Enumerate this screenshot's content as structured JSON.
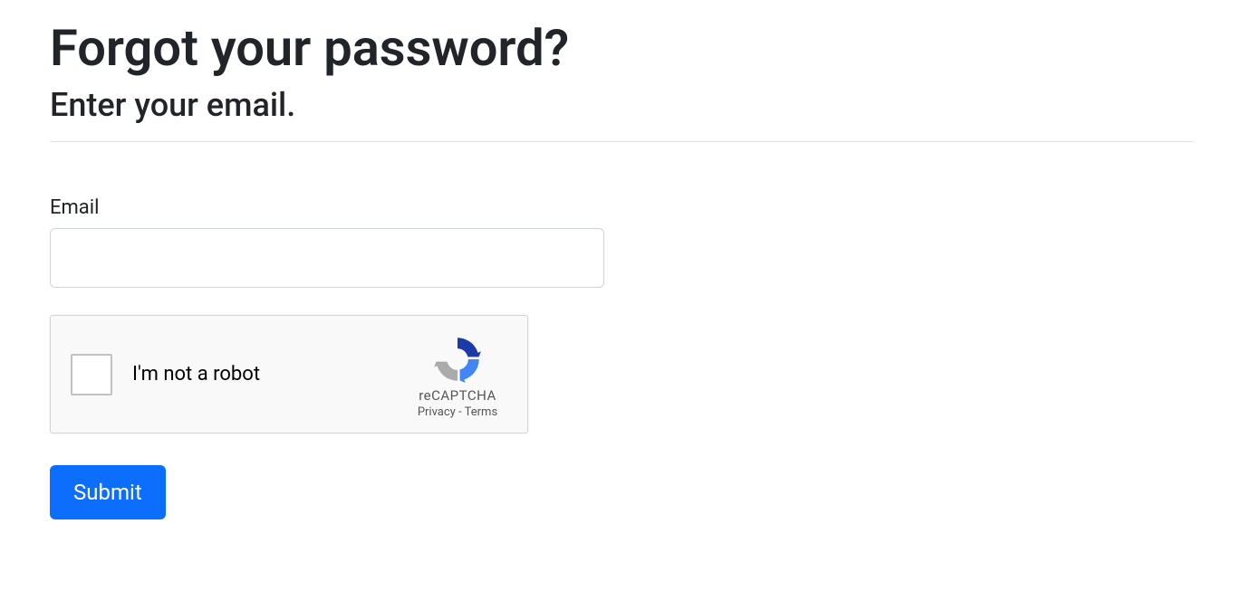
{
  "heading": {
    "title": "Forgot your password?",
    "subtitle": "Enter your email."
  },
  "form": {
    "email_label": "Email",
    "email_value": "",
    "submit_label": "Submit"
  },
  "recaptcha": {
    "checkbox_label": "I'm not a robot",
    "brand": "reCAPTCHA",
    "privacy_label": "Privacy",
    "separator": " - ",
    "terms_label": "Terms"
  }
}
